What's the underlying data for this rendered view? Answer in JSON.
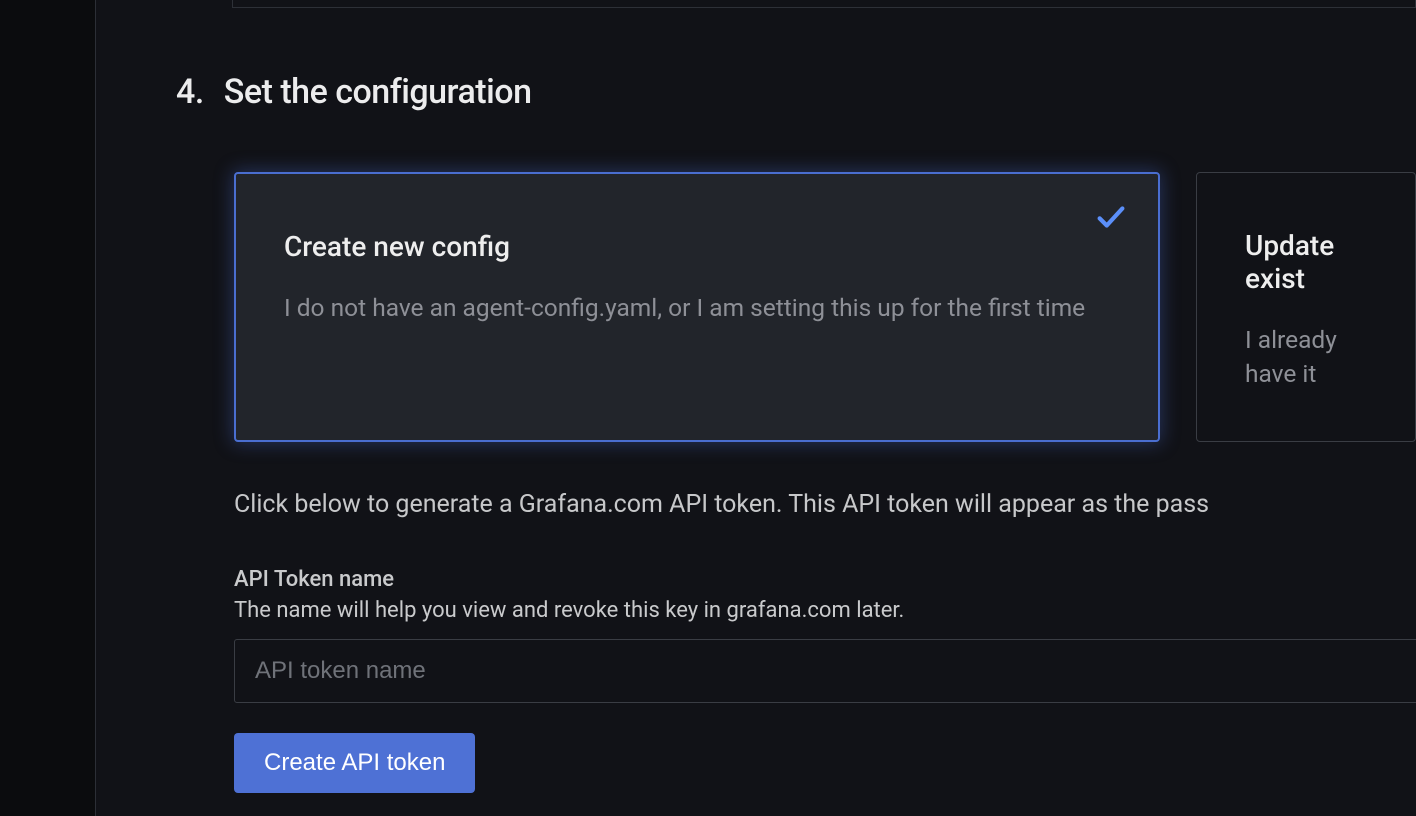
{
  "step": {
    "number": "4.",
    "title": "Set the configuration"
  },
  "options": {
    "create": {
      "title": "Create new config",
      "description": "I do not have an agent-config.yaml, or I am setting this up for the first time"
    },
    "update": {
      "title": "Update exist",
      "description": "I already have it"
    }
  },
  "instruction": "Click below to generate a Grafana.com API token. This API token will appear as the pass",
  "token_field": {
    "label": "API Token name",
    "help": "The name will help you view and revoke this key in grafana.com later.",
    "placeholder": "API token name",
    "value": ""
  },
  "button": {
    "create_token": "Create API token"
  }
}
